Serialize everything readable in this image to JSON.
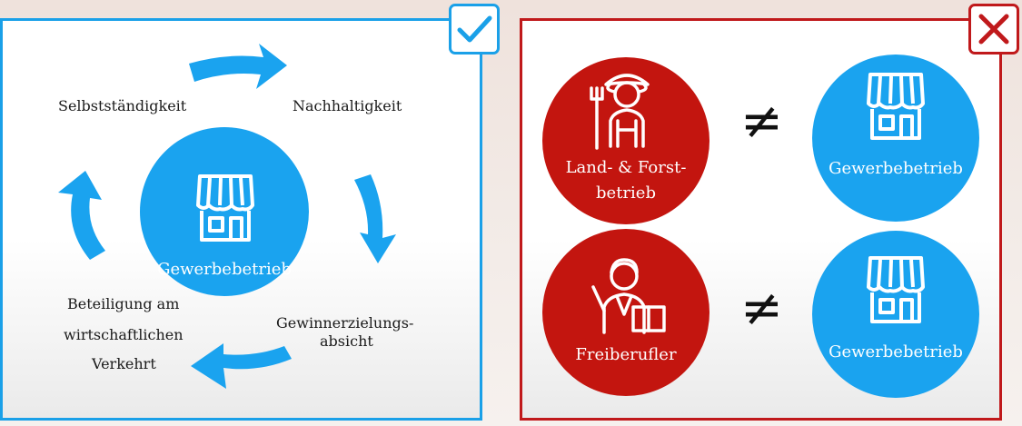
{
  "left_panel": {
    "center_label": "Gewerbebetrieb",
    "criteria": {
      "top_left": "Selbstständigkeit",
      "top_right": "Nachhaltigkeit",
      "bottom_right_1": "Gewinnerzielungs-",
      "bottom_right_2": "absicht",
      "bottom_left_1": "Beteiligung am",
      "bottom_left_2": "wirtschaftlichen",
      "bottom_left_3": "Verkehrt"
    },
    "badge_icon": "checkmark-icon",
    "accent": "#1aa0e8"
  },
  "right_panel": {
    "badge_icon": "cross-icon",
    "accent": "#c0191b",
    "rows": [
      {
        "left_line1": "Land- & Forst-",
        "left_line2": "betrieb",
        "left_icon": "farmer-icon",
        "relation": "≠",
        "right_label": "Gewerbebetrieb",
        "right_icon": "shop-icon"
      },
      {
        "left_line1": "Freiberufler",
        "left_icon": "teacher-icon",
        "relation": "≠",
        "right_label": "Gewerbebetrieb",
        "right_icon": "shop-icon"
      }
    ]
  },
  "colors": {
    "blue": "#1aa3ef",
    "red": "#c3150f"
  }
}
